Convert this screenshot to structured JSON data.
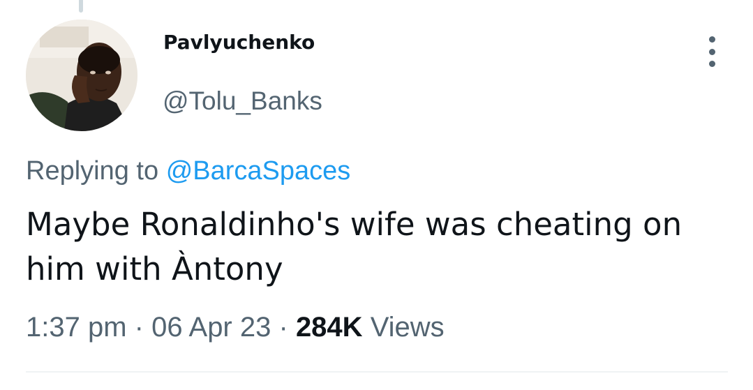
{
  "tweet": {
    "author": {
      "display_name": "Pavlyuchenko",
      "handle": "@Tolu_Banks",
      "avatar": "user-avatar-photo"
    },
    "more_icon": "more-vertical-icon",
    "reply": {
      "prefix": "Replying to",
      "mention": "@BarcaSpaces"
    },
    "text": "Maybe Ronaldinho's wife was cheating on him with Àntony",
    "meta": {
      "time": "1:37 pm",
      "separator": "·",
      "date": "06 Apr 23",
      "views_count": "284K",
      "views_label": "Views"
    }
  },
  "colors": {
    "primary_text": "#0f1419",
    "secondary_text": "#536471",
    "link": "#1d9bf0",
    "divider": "#eff3f4"
  }
}
